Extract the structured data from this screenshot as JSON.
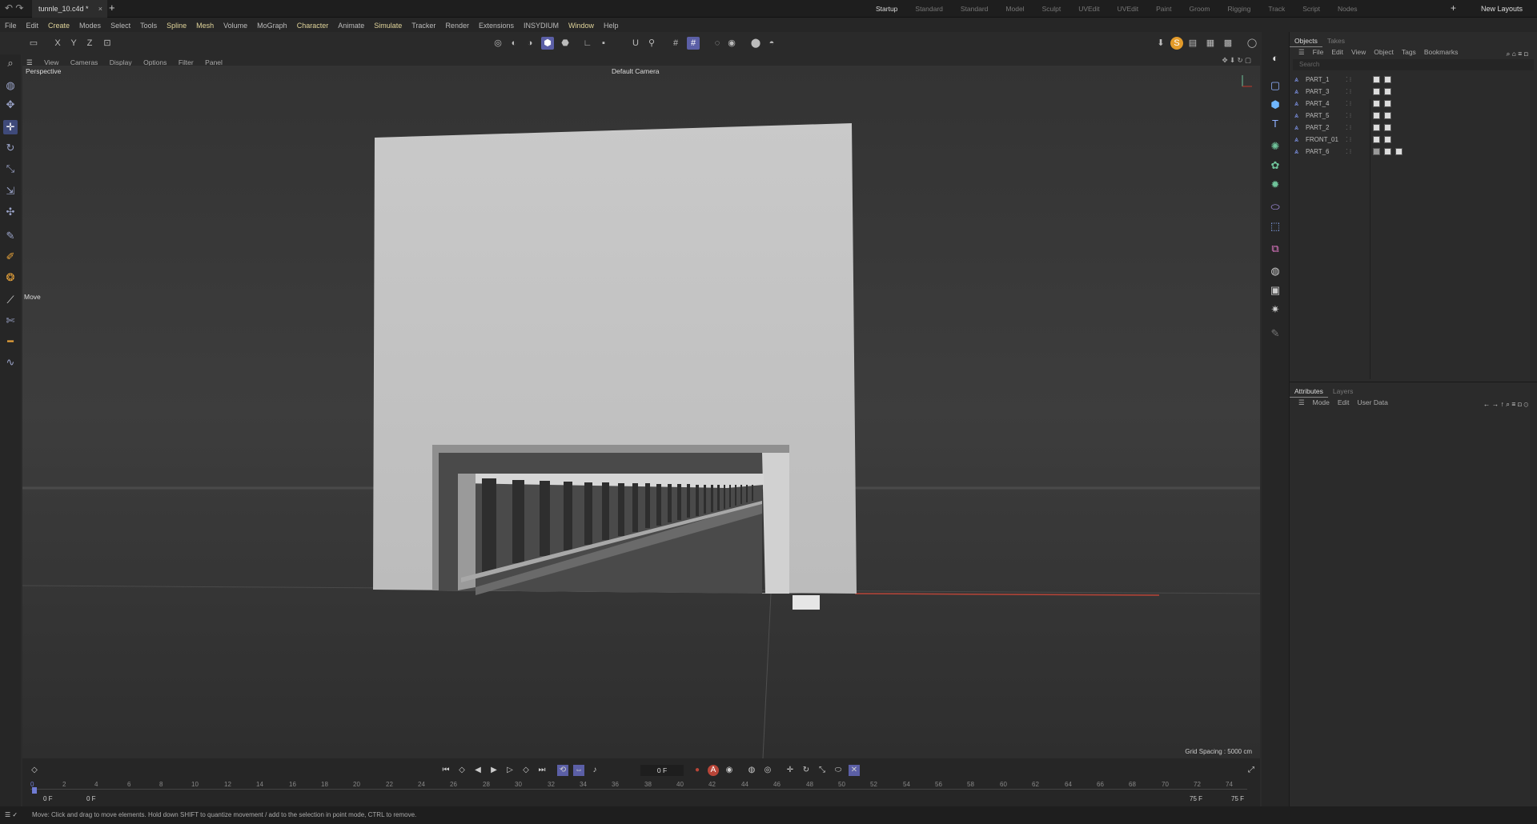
{
  "titlebar": {
    "document_tab": "tunnle_10.c4d *",
    "close_glyph": "×",
    "new_tab_glyph": "+",
    "layouts": [
      "Startup",
      "Standard",
      "Standard",
      "Model",
      "Sculpt",
      "UVEdit",
      "UVEdit",
      "Paint",
      "Groom",
      "Rigging",
      "Track",
      "Script",
      "Nodes"
    ],
    "active_layout": "Startup",
    "new_layouts_label": "New Layouts"
  },
  "menubar": {
    "items": [
      "File",
      "Edit",
      "Create",
      "Modes",
      "Select",
      "Tools",
      "Spline",
      "Mesh",
      "Volume",
      "MoGraph",
      "Character",
      "Animate",
      "Simulate",
      "Tracker",
      "Render",
      "Extensions",
      "INSYDIUM",
      "Window",
      "Help"
    ]
  },
  "toolbar": {
    "axis_x": "X",
    "axis_y": "Y",
    "axis_z": "Z"
  },
  "viewport": {
    "menu": [
      "View",
      "Cameras",
      "Display",
      "Options",
      "Filter",
      "Panel"
    ],
    "projection": "Perspective",
    "camera": "Default Camera",
    "grid_spacing": "Grid Spacing : 5000 cm",
    "tool_label": "Move"
  },
  "objects_panel": {
    "tabs": [
      "Objects",
      "Takes"
    ],
    "menu": [
      "File",
      "Edit",
      "View",
      "Object",
      "Tags",
      "Bookmarks"
    ],
    "search_placeholder": "Search",
    "objects": [
      {
        "name": "PART_1",
        "tags": 2
      },
      {
        "name": "PART_3",
        "tags": 2
      },
      {
        "name": "PART_4",
        "tags": 2
      },
      {
        "name": "PART_5",
        "tags": 2
      },
      {
        "name": "PART_2",
        "tags": 2
      },
      {
        "name": "FRONT_01",
        "tags": 2
      },
      {
        "name": "PART_6",
        "tags": 3
      }
    ]
  },
  "attributes_panel": {
    "tabs": [
      "Attributes",
      "Layers"
    ],
    "menu": [
      "Mode",
      "Edit",
      "User Data"
    ]
  },
  "timeline": {
    "current_frame": "0 F",
    "ruler_labels": [
      "0",
      "2",
      "4",
      "6",
      "8",
      "10",
      "12",
      "14",
      "16",
      "18",
      "20",
      "22",
      "24",
      "26",
      "28",
      "30",
      "32",
      "34",
      "36",
      "38",
      "40",
      "42",
      "44",
      "46",
      "48",
      "50",
      "52",
      "54",
      "56",
      "58",
      "60",
      "62",
      "64",
      "66",
      "68",
      "70",
      "72",
      "74"
    ],
    "start_frame": "0 F",
    "preview_start": "0 F",
    "preview_end": "75 F",
    "end_frame": "75 F"
  },
  "statusbar": {
    "message": "Move: Click and drag to move elements. Hold down SHIFT to quantize movement / add to the selection in point mode, CTRL to remove."
  },
  "colors": {
    "selected_tool": "#5b5fa6",
    "object_icon": "#88a0ff",
    "x_axis": "#c0392b"
  }
}
